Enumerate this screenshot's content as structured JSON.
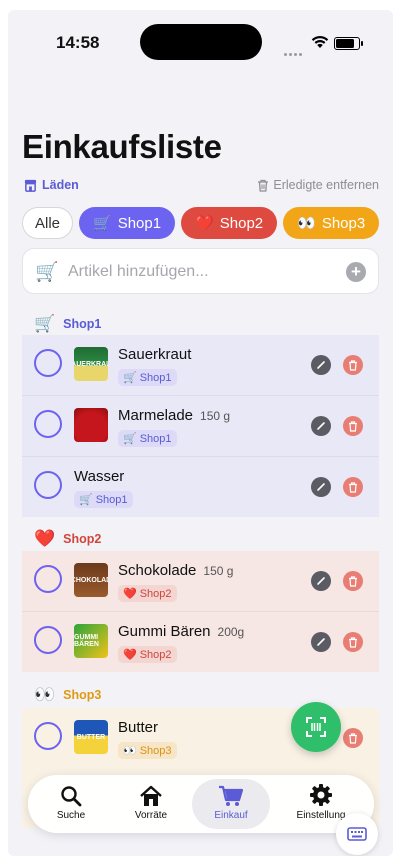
{
  "status": {
    "time": "14:58"
  },
  "header": {
    "title": "Einkaufsliste",
    "shops_link": "Läden",
    "clear_done": "Erledigte entfernen"
  },
  "filters": [
    {
      "label": "Alle",
      "emoji": ""
    },
    {
      "label": "Shop1",
      "emoji": "🛒",
      "color": "#6c63f0"
    },
    {
      "label": "Shop2",
      "emoji": "❤️",
      "color": "#de4a3f"
    },
    {
      "label": "Shop3",
      "emoji": "👀",
      "color": "#f2a516"
    }
  ],
  "add_item": {
    "placeholder": "Artikel hinzufügen..."
  },
  "sections": [
    {
      "shop": "Shop1",
      "emoji": "🛒",
      "color": "#5b5bd6",
      "items": [
        {
          "name": "Sauerkraut",
          "qty": "",
          "tag": "Shop1",
          "tag_emoji": "🛒",
          "thumb": "SAUERKRAUT"
        },
        {
          "name": "Marmelade",
          "qty": "150 g",
          "tag": "Shop1",
          "tag_emoji": "🛒",
          "thumb": ""
        },
        {
          "name": "Wasser",
          "qty": "",
          "tag": "Shop1",
          "tag_emoji": "🛒",
          "thumb": ""
        }
      ]
    },
    {
      "shop": "Shop2",
      "emoji": "❤️",
      "color": "#d2453b",
      "items": [
        {
          "name": "Schokolade",
          "qty": "150 g",
          "tag": "Shop2",
          "tag_emoji": "❤️",
          "thumb": "SCHOKOLADE"
        },
        {
          "name": "Gummi Bären",
          "qty": "200g",
          "tag": "Shop2",
          "tag_emoji": "❤️",
          "thumb": "GUMMI BÄREN"
        }
      ]
    },
    {
      "shop": "Shop3",
      "emoji": "👀",
      "color": "#e09a12",
      "items": [
        {
          "name": "Butter",
          "qty": "",
          "tag": "Shop3",
          "tag_emoji": "👀",
          "thumb": "BUTTER"
        }
      ]
    }
  ],
  "tabs": [
    {
      "label": "Suche",
      "icon": "search-icon"
    },
    {
      "label": "Vorräte",
      "icon": "house-icon"
    },
    {
      "label": "Einkauf",
      "icon": "cart-icon",
      "active": true
    },
    {
      "label": "Einstellung",
      "icon": "gear-icon"
    }
  ]
}
